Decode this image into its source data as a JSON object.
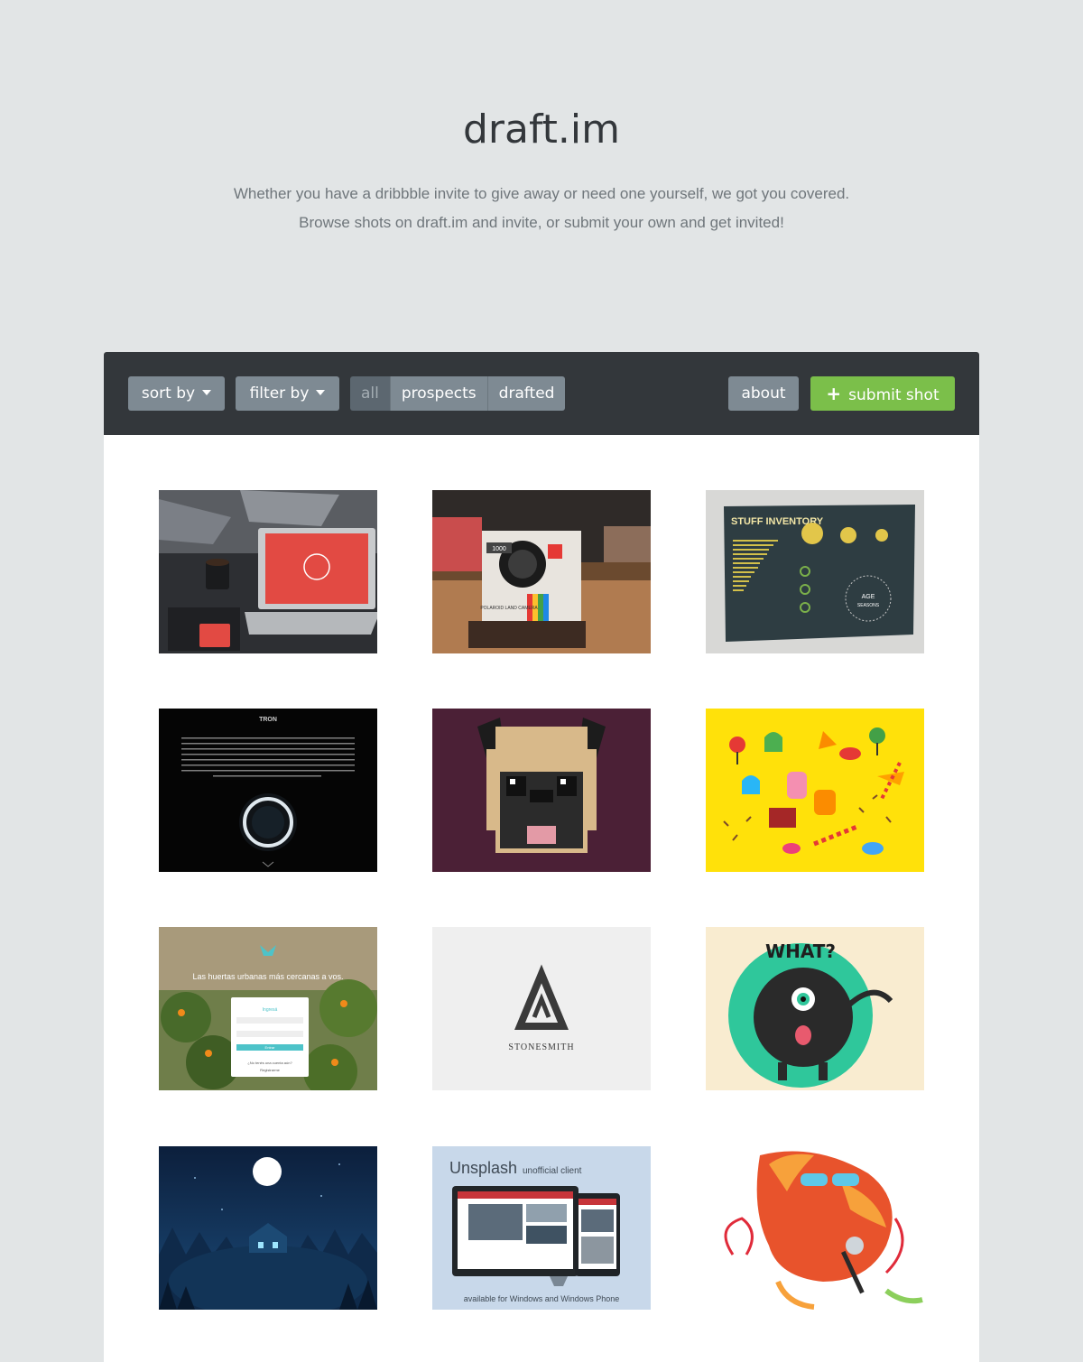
{
  "header": {
    "site_title": "draft.im",
    "tagline_line1": "Whether you have a dribbble invite to give away or need one yourself, we got you covered.",
    "tagline_line2": "Browse shots on draft.im and invite, or submit your own and get invited!"
  },
  "toolbar": {
    "sort_label": "sort by",
    "filter_label": "filter by",
    "segments": [
      "all",
      "prospects",
      "drafted"
    ],
    "active_segment": "all",
    "about_label": "about",
    "submit_label": "submit shot"
  },
  "colors": {
    "page_bg": "#e2e5e6",
    "toolbar_bg": "#33373b",
    "button_gray": "#7e8a93",
    "accent_green": "#7bbf4a"
  },
  "shots": {
    "infographic_title": "STUFF INVENTORY",
    "infographic_badge": "AGE",
    "infographic_badge2": "SEASONS",
    "tron_logo": "TRON",
    "camera_label": "1000",
    "camera_name": "POLAROID LAND CAMERA",
    "huertas_heading": "Las huertas urbanas más cercanas a vos.",
    "huertas_form_title": "Ingresá",
    "huertas_button": "Entrar",
    "huertas_footer": "¿No tenés una cuenta aún?",
    "huertas_register": "Registrarme",
    "stonesmith": "STONESMITH",
    "what": "WHAT?",
    "unsplash_title": "Unsplash",
    "unsplash_subtitle": "unofficial client",
    "unsplash_footer": "available for Windows and Windows Phone"
  }
}
